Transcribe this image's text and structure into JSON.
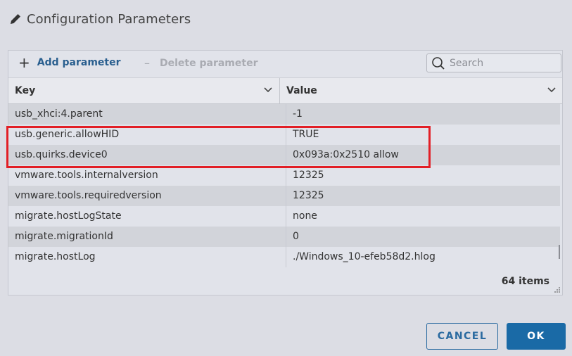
{
  "dialog": {
    "title": "Configuration Parameters"
  },
  "toolbar": {
    "add_label": "Add parameter",
    "delete_label": "Delete parameter",
    "search_placeholder": "Search"
  },
  "table": {
    "columns": [
      "Key",
      "Value"
    ],
    "rows": [
      {
        "key": "usb_xhci:4.parent",
        "value": "-1"
      },
      {
        "key": "usb.generic.allowHID",
        "value": "TRUE"
      },
      {
        "key": "usb.quirks.device0",
        "value": "0x093a:0x2510 allow"
      },
      {
        "key": "vmware.tools.internalversion",
        "value": "12325"
      },
      {
        "key": "vmware.tools.requiredversion",
        "value": "12325"
      },
      {
        "key": "migrate.hostLogState",
        "value": "none"
      },
      {
        "key": "migrate.migrationId",
        "value": "0"
      },
      {
        "key": "migrate.hostLog",
        "value": "./Windows_10-efeb58d2.hlog"
      }
    ],
    "item_count": "64 items"
  },
  "buttons": {
    "cancel": "CANCEL",
    "ok": "OK"
  },
  "colors": {
    "accent": "#1a6aa6",
    "highlight": "#e21f26"
  }
}
